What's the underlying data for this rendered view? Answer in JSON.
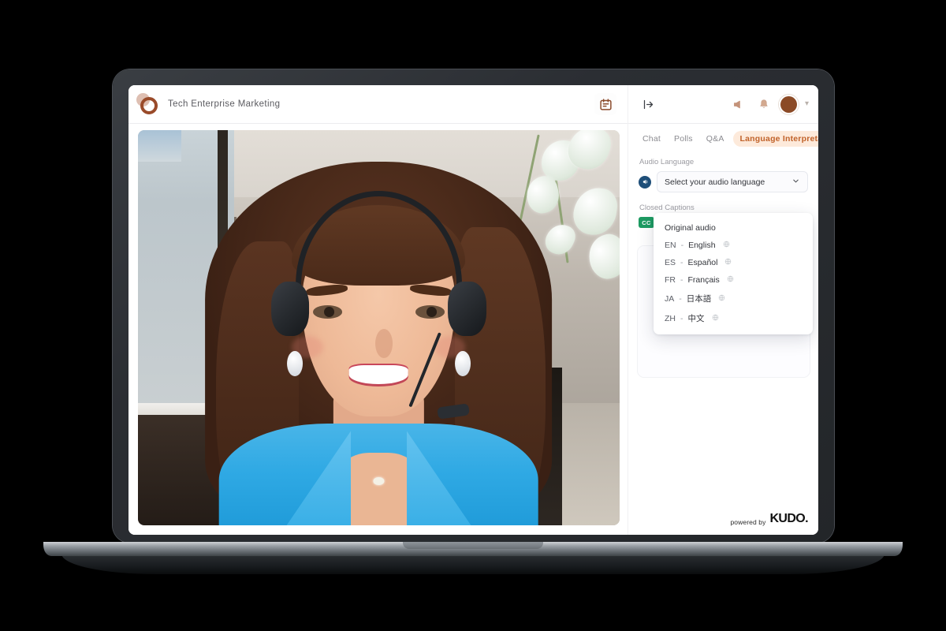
{
  "app": {
    "brand_title": "Tech Enterprise Marketing",
    "logo_icon": "kudo-rings-logo",
    "calendar_icon": "calendar-icon"
  },
  "right_panel": {
    "collapse_icon": "collapse-panel-icon",
    "announcement_icon": "megaphone-icon",
    "notification_icon": "bell-icon",
    "avatar_icon": "user-avatar",
    "account_chevron_icon": "chevron-down-icon",
    "tabs": [
      {
        "label": "Chat",
        "active": false
      },
      {
        "label": "Polls",
        "active": false
      },
      {
        "label": "Q&A",
        "active": false
      },
      {
        "label": "Language Interpretation",
        "active": true
      }
    ],
    "audio": {
      "label": "Audio Language",
      "icon": "speaker-icon",
      "select_value": "Select your audio language",
      "select_chevron_icon": "chevron-down-icon"
    },
    "captions": {
      "label": "Closed Captions",
      "badge": "CC"
    },
    "dropdown": {
      "options": [
        {
          "code": "",
          "dash": "",
          "name": "Original audio",
          "globe": false
        },
        {
          "code": "EN",
          "dash": "-",
          "name": "English",
          "globe": true
        },
        {
          "code": "ES",
          "dash": "-",
          "name": "Español",
          "globe": true
        },
        {
          "code": "FR",
          "dash": "-",
          "name": "Français",
          "globe": true
        },
        {
          "code": "JA",
          "dash": "-",
          "name": "日本語",
          "globe": true
        },
        {
          "code": "ZH",
          "dash": "-",
          "name": "中文",
          "globe": true
        }
      ]
    },
    "footer": {
      "powered_by": "powered by",
      "brand": "KUDO."
    }
  },
  "colors": {
    "accent": "#c1622a",
    "accent_bg": "#fdeadb",
    "brand_brown": "#9a4b2a",
    "cc_green": "#1d9b62",
    "audio_blue": "#1f4f79"
  }
}
